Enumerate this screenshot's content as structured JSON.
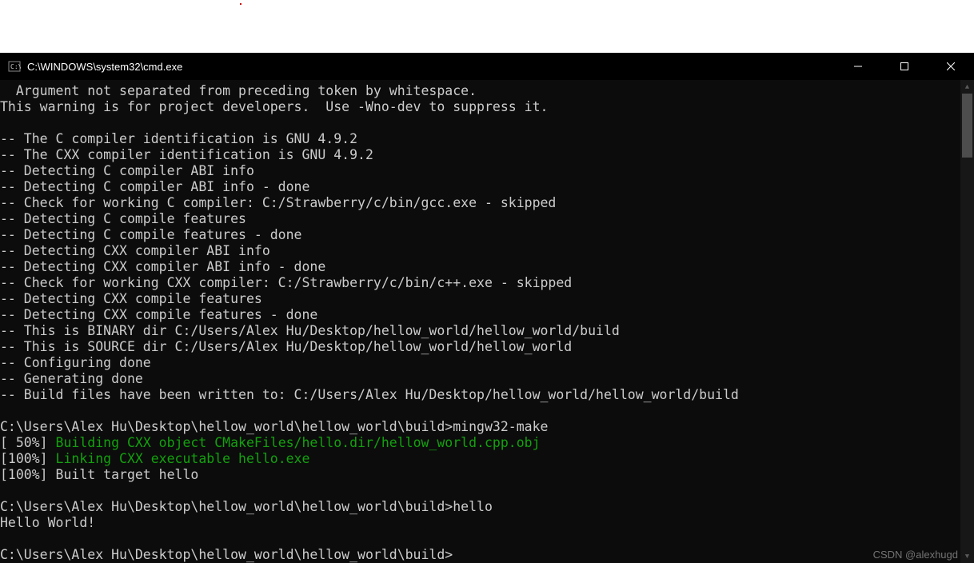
{
  "window": {
    "title": "C:\\WINDOWS\\system32\\cmd.exe"
  },
  "terminal": {
    "lines": [
      {
        "text": "  Argument not separated from preceding token by whitespace."
      },
      {
        "text": "This warning is for project developers.  Use -Wno-dev to suppress it."
      },
      {
        "text": ""
      },
      {
        "text": "-- The C compiler identification is GNU 4.9.2"
      },
      {
        "text": "-- The CXX compiler identification is GNU 4.9.2"
      },
      {
        "text": "-- Detecting C compiler ABI info"
      },
      {
        "text": "-- Detecting C compiler ABI info - done"
      },
      {
        "text": "-- Check for working C compiler: C:/Strawberry/c/bin/gcc.exe - skipped"
      },
      {
        "text": "-- Detecting C compile features"
      },
      {
        "text": "-- Detecting C compile features - done"
      },
      {
        "text": "-- Detecting CXX compiler ABI info"
      },
      {
        "text": "-- Detecting CXX compiler ABI info - done"
      },
      {
        "text": "-- Check for working CXX compiler: C:/Strawberry/c/bin/c++.exe - skipped"
      },
      {
        "text": "-- Detecting CXX compile features"
      },
      {
        "text": "-- Detecting CXX compile features - done"
      },
      {
        "text": "-- This is BINARY dir C:/Users/Alex Hu/Desktop/hellow_world/hellow_world/build"
      },
      {
        "text": "-- This is SOURCE dir C:/Users/Alex Hu/Desktop/hellow_world/hellow_world"
      },
      {
        "text": "-- Configuring done"
      },
      {
        "text": "-- Generating done"
      },
      {
        "text": "-- Build files have been written to: C:/Users/Alex Hu/Desktop/hellow_world/hellow_world/build"
      },
      {
        "text": ""
      },
      {
        "text": "C:\\Users\\Alex Hu\\Desktop\\hellow_world\\hellow_world\\build>mingw32-make"
      },
      {
        "segments": [
          {
            "text": "[ 50%] ",
            "class": ""
          },
          {
            "text": "Building CXX object CMakeFiles/hello.dir/hellow_world.cpp.obj",
            "class": "green"
          }
        ]
      },
      {
        "segments": [
          {
            "text": "[100%] ",
            "class": ""
          },
          {
            "text": "Linking CXX executable hello.exe",
            "class": "green"
          }
        ]
      },
      {
        "text": "[100%] Built target hello"
      },
      {
        "text": ""
      },
      {
        "text": "C:\\Users\\Alex Hu\\Desktop\\hellow_world\\hellow_world\\build>hello"
      },
      {
        "text": "Hello World!"
      },
      {
        "text": ""
      },
      {
        "text": "C:\\Users\\Alex Hu\\Desktop\\hellow_world\\hellow_world\\build>"
      }
    ]
  },
  "watermark": "CSDN @alexhugd"
}
